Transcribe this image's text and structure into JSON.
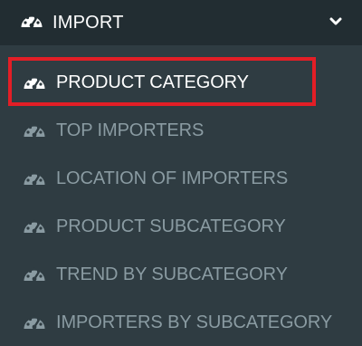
{
  "header": {
    "label": "IMPORT",
    "icon": "dashboard-icon",
    "chevron": "chevron-down-icon"
  },
  "submenu": {
    "items": [
      {
        "label": "PRODUCT CATEGORY",
        "icon": "dashboard-icon",
        "active": true
      },
      {
        "label": "TOP IMPORTERS",
        "icon": "dashboard-icon",
        "active": false
      },
      {
        "label": "LOCATION OF IMPORTERS",
        "icon": "dashboard-icon",
        "active": false
      },
      {
        "label": "PRODUCT SUBCATEGORY",
        "icon": "dashboard-icon",
        "active": false
      },
      {
        "label": "TREND BY SUBCATEGORY",
        "icon": "dashboard-icon",
        "active": false
      },
      {
        "label": "IMPORTERS BY SUBCATEGORY",
        "icon": "dashboard-icon",
        "active": false
      }
    ]
  },
  "colors": {
    "sidebar_bg": "#2f3c42",
    "header_bg": "#222d32",
    "active_text": "#ffffff",
    "inactive_text": "#8a9ba2",
    "highlight_border": "#e31e26"
  }
}
